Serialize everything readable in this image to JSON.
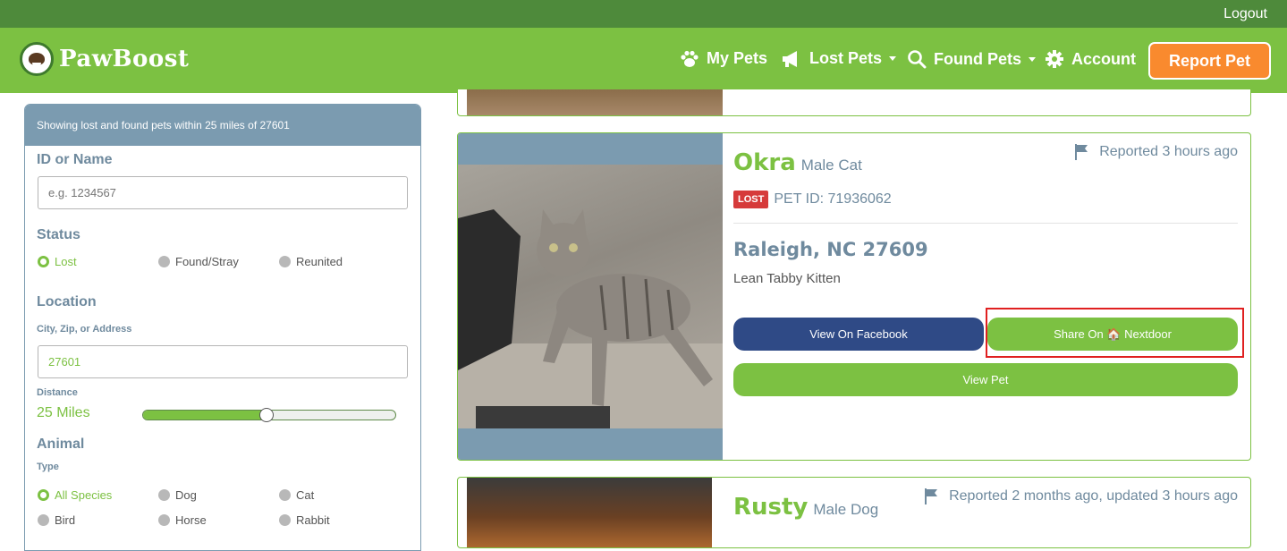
{
  "topbar": {
    "logout": "Logout"
  },
  "brand": {
    "name": "PawBoost"
  },
  "nav": {
    "my_pets": "My Pets",
    "lost_pets": "Lost Pets",
    "found_pets": "Found Pets",
    "account": "Account",
    "report_pet": "Report Pet"
  },
  "sidebar": {
    "header": "Showing lost and found pets within 25 miles of 27601",
    "id_label": "ID or Name",
    "id_placeholder": "e.g. 1234567",
    "status_label": "Status",
    "status_options": [
      "Lost",
      "Found/Stray",
      "Reunited"
    ],
    "status_selected": "Lost",
    "location_label": "Location",
    "location_sublabel": "City, Zip, or Address",
    "location_value": "27601",
    "distance_label": "Distance",
    "distance_value": "25 Miles",
    "distance_fraction": 0.49,
    "animal_label": "Animal",
    "type_label": "Type",
    "species_row1": [
      "All Species",
      "Dog",
      "Cat"
    ],
    "species_row2": [
      "Bird",
      "Horse",
      "Rabbit"
    ],
    "species_selected": "All Species"
  },
  "cards": [
    {
      "name": "Okra",
      "kind": "Male Cat",
      "reported": "Reported 3 hours ago",
      "status_badge": "LOST",
      "pet_id": "PET ID: 71936062",
      "location": "Raleigh, NC 27609",
      "description": "Lean Tabby Kitten",
      "facebook_btn": "View On Facebook",
      "nextdoor_btn": "Share On 🏠 Nextdoor",
      "view_btn": "View Pet"
    },
    {
      "name": "Rusty",
      "kind": "Male Dog",
      "reported": "Reported 2 months ago, updated 3 hours ago"
    }
  ],
  "colors": {
    "topbar": "#4e8a3b",
    "navbar": "#7cc142",
    "report": "#f98a2e",
    "slate": "#7b9bb0",
    "facebook": "#2f4a86",
    "lost": "#d63a3a",
    "highlight": "#e02020"
  }
}
